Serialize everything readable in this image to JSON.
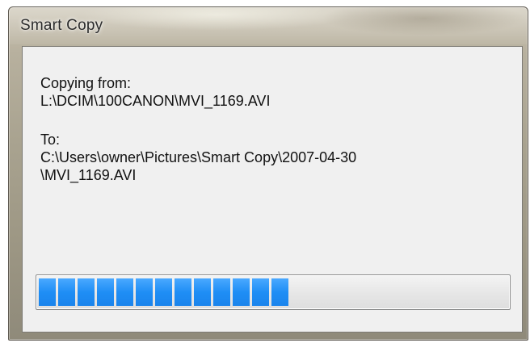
{
  "window": {
    "title": "Smart Copy"
  },
  "content": {
    "from_label": "Copying from:",
    "from_path": "L:\\DCIM\\100CANON\\MVI_1169.AVI",
    "to_label": "To:",
    "to_path_line1": "C:\\Users\\owner\\Pictures\\Smart Copy\\2007-04-30",
    "to_path_line2": "\\MVI_1169.AVI"
  },
  "progress": {
    "fraction": 0.57,
    "accent_color": "#1f8ef5"
  }
}
